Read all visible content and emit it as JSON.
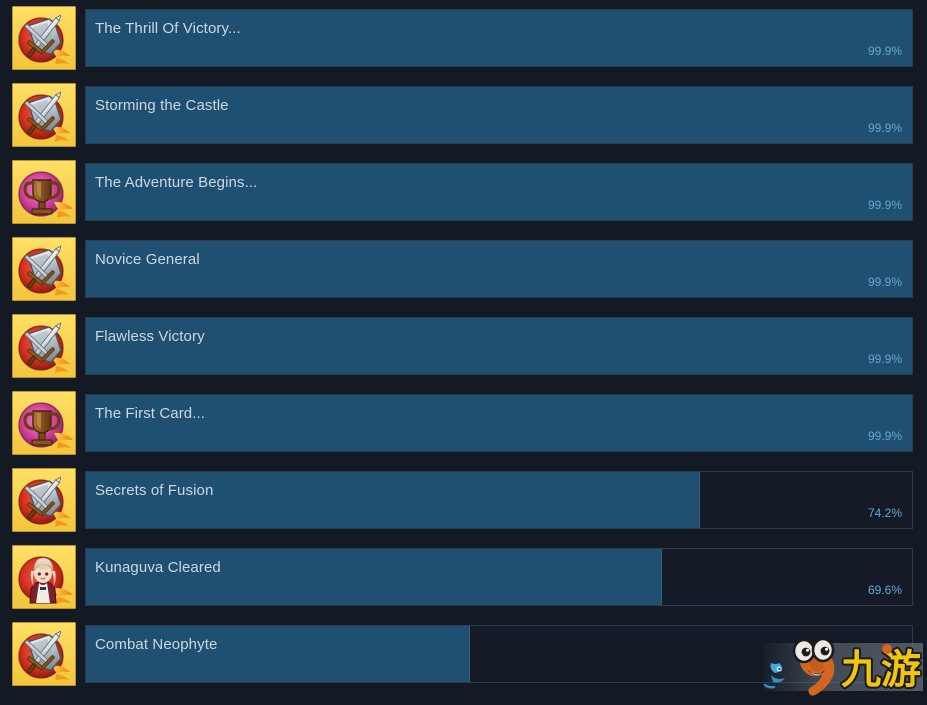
{
  "page": {
    "background_color": "#141a24",
    "bar_track_color": "#151b26",
    "bar_fill_color": "#1f5072",
    "bar_border_color": "#2b3a4c",
    "name_text_color": "#ccd7e0",
    "percent_text_color": "#66a6d0"
  },
  "achievements": [
    {
      "name": "The Thrill Of Victory...",
      "percent_label": "99.9%",
      "percent_value": 99.9,
      "icon": "sword-shield-icon",
      "icon_style": "sword"
    },
    {
      "name": "Storming the Castle",
      "percent_label": "99.9%",
      "percent_value": 99.9,
      "icon": "sword-shield-icon",
      "icon_style": "sword"
    },
    {
      "name": "The Adventure Begins...",
      "percent_label": "99.9%",
      "percent_value": 99.9,
      "icon": "trophy-cup-icon",
      "icon_style": "trophy"
    },
    {
      "name": "Novice General",
      "percent_label": "99.9%",
      "percent_value": 99.9,
      "icon": "sword-shield-icon",
      "icon_style": "sword"
    },
    {
      "name": "Flawless Victory",
      "percent_label": "99.9%",
      "percent_value": 99.9,
      "icon": "sword-shield-icon",
      "icon_style": "sword"
    },
    {
      "name": "The First Card...",
      "percent_label": "99.9%",
      "percent_value": 99.9,
      "icon": "trophy-cup-icon",
      "icon_style": "trophy"
    },
    {
      "name": "Secrets of Fusion",
      "percent_label": "74.2%",
      "percent_value": 74.2,
      "icon": "sword-shield-icon",
      "icon_style": "sword"
    },
    {
      "name": "Kunaguva Cleared",
      "percent_label": "69.6%",
      "percent_value": 69.6,
      "icon": "anime-character-icon",
      "icon_style": "character"
    },
    {
      "name": "Combat Neophyte",
      "percent_label": "",
      "percent_value": 46.4,
      "icon": "sword-shield-icon",
      "icon_style": "sword"
    }
  ],
  "watermark": {
    "text": "九游",
    "mascot_color": "#d2661f",
    "text_color": "#f2c60d"
  }
}
